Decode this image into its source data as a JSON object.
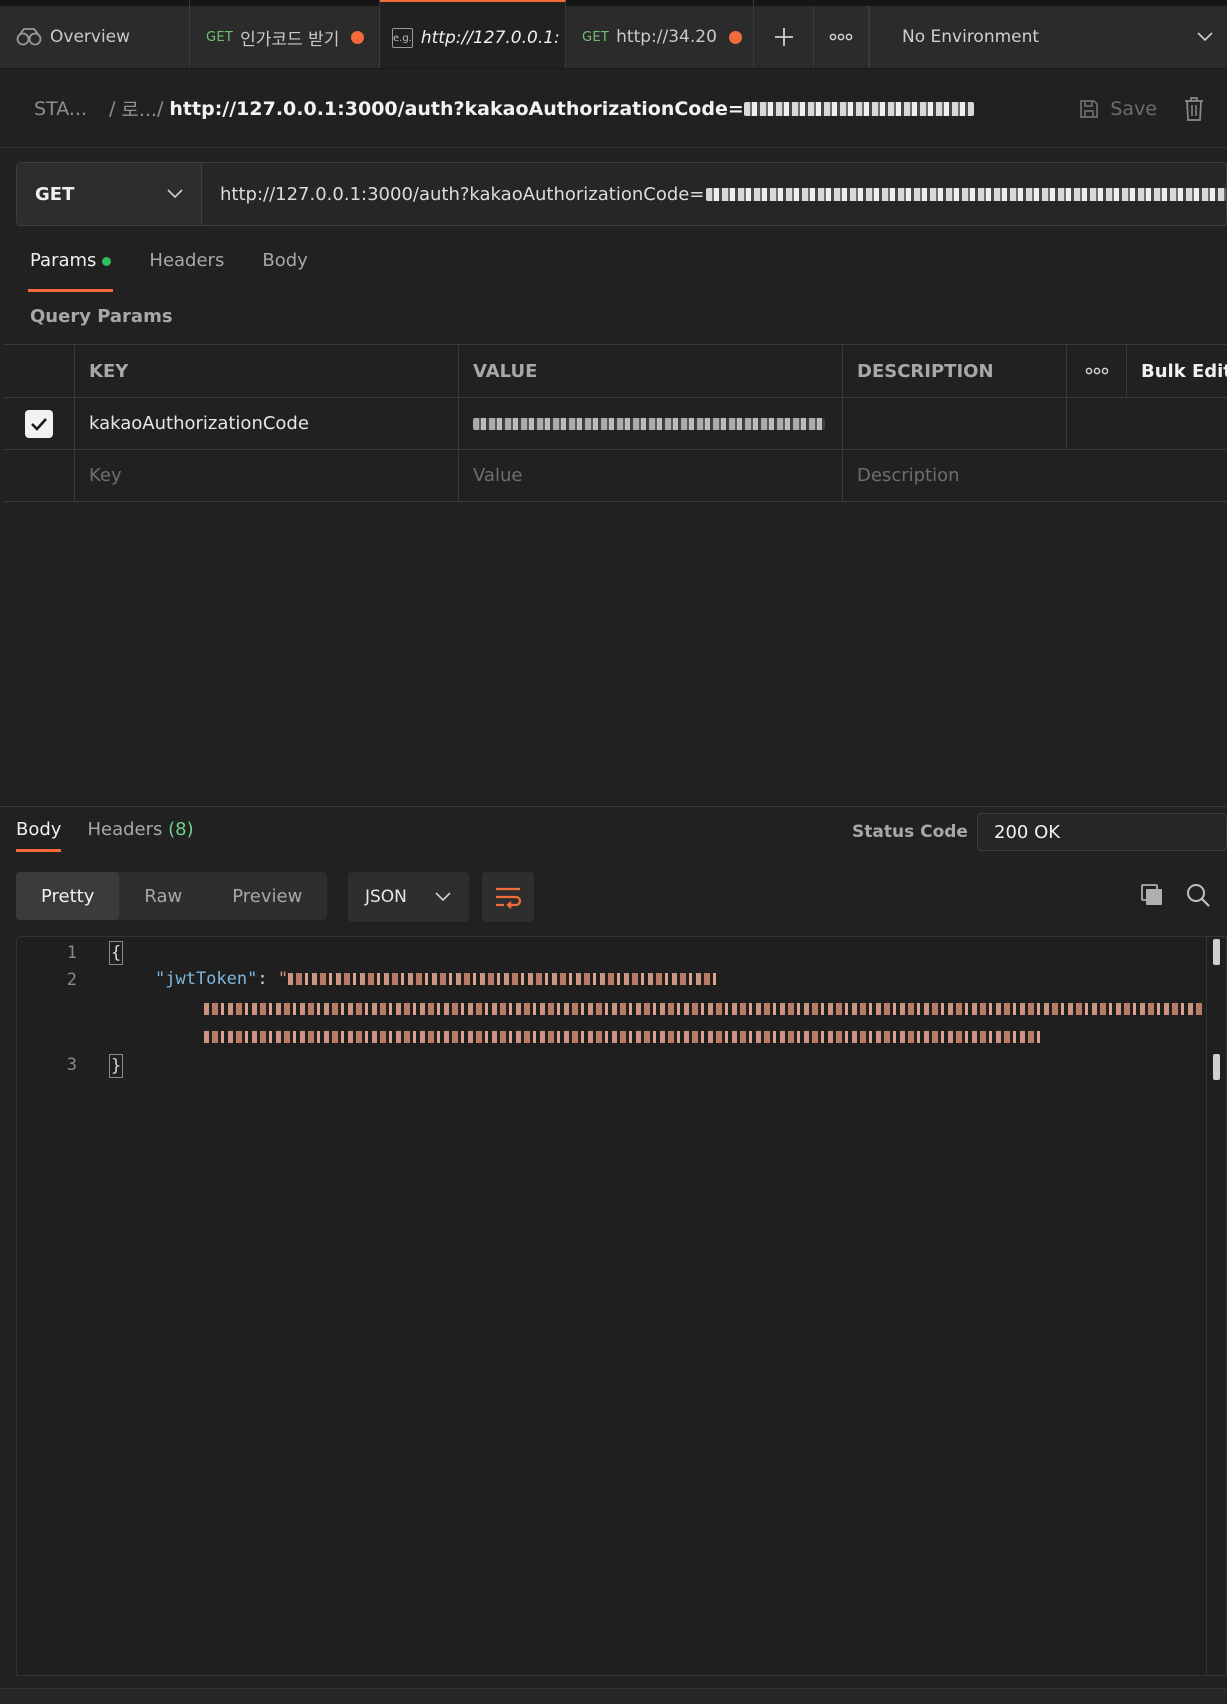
{
  "tabbar": {
    "overview_label": "Overview",
    "tabs": [
      {
        "method": "GET",
        "label": "인가코드 받기",
        "unsaved": true
      },
      {
        "method": "e.g.",
        "label": "http://127.0.0.1:",
        "unsaved": false
      },
      {
        "method": "GET",
        "label": "http://34.20",
        "unsaved": true
      }
    ],
    "environment": "No Environment"
  },
  "breadcrumb": {
    "collection": "STA...",
    "folder": "로...",
    "separator_1": "/",
    "separator_2": "/",
    "request_url": "http://127.0.0.1:3000/auth?kakaoAuthorizationCode=",
    "save_label": "Save"
  },
  "request": {
    "method": "GET",
    "url": "http://127.0.0.1:3000/auth?kakaoAuthorizationCode="
  },
  "request_tabs": {
    "params": "Params",
    "headers": "Headers",
    "body": "Body"
  },
  "query_params": {
    "title": "Query Params",
    "columns": {
      "key": "KEY",
      "value": "VALUE",
      "description": "DESCRIPTION",
      "bulk_edit": "Bulk Edit"
    },
    "rows": [
      {
        "enabled": true,
        "key": "kakaoAuthorizationCode",
        "value": "",
        "description": ""
      }
    ],
    "placeholders": {
      "key": "Key",
      "value": "Value",
      "description": "Description"
    }
  },
  "response": {
    "tabs": {
      "body": "Body",
      "headers": "Headers",
      "headers_count": "(8)"
    },
    "status_label": "Status Code",
    "status_value": "200 OK",
    "formats": {
      "pretty": "Pretty",
      "raw": "Raw",
      "preview": "Preview"
    },
    "language": "JSON",
    "code": {
      "line_numbers": [
        "1",
        "2",
        "3"
      ],
      "open_brace": "{",
      "close_brace": "}",
      "key": "\"jwtToken\"",
      "colon": ": ",
      "string_open": "\""
    }
  },
  "colors": {
    "accent": "#f26b3a",
    "method_get": "#6fbf73",
    "json_key": "#7fb7e0",
    "json_string": "#d9937a"
  }
}
